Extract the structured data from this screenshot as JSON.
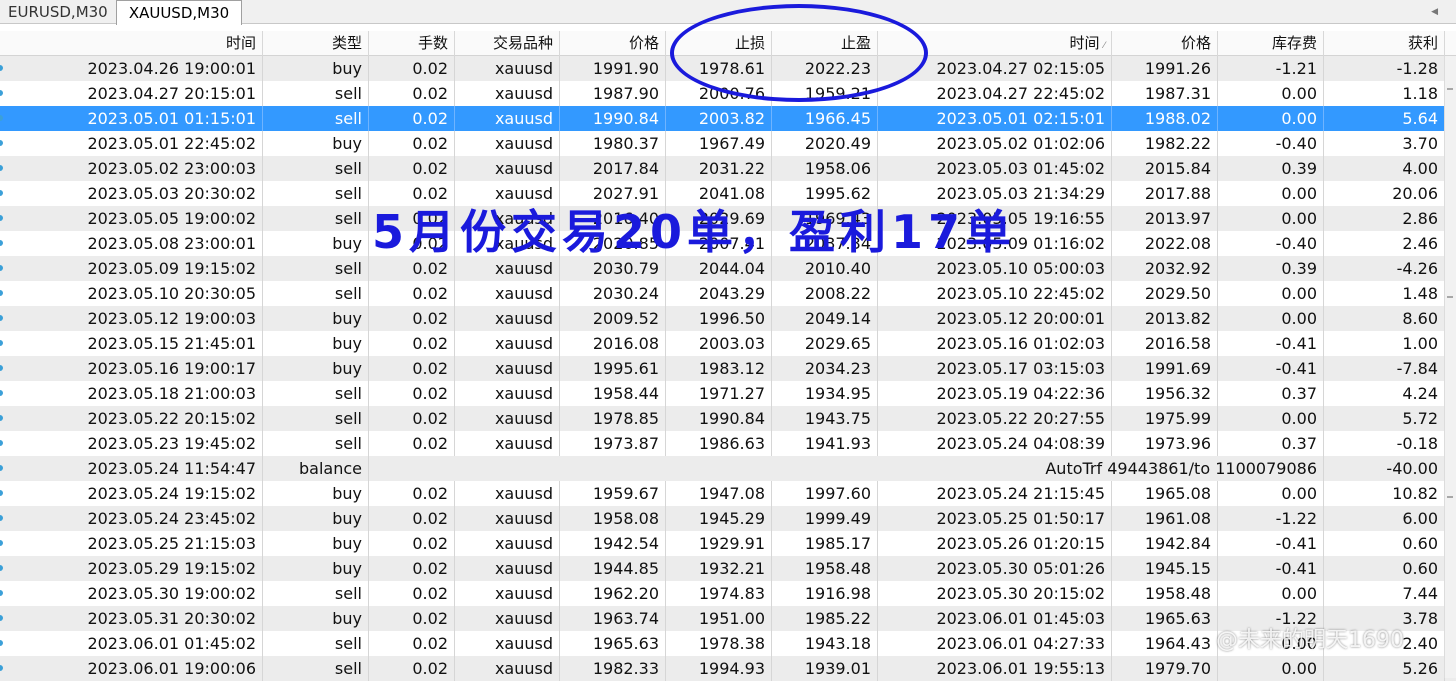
{
  "tabs": [
    {
      "label": "EURUSD,M30"
    },
    {
      "label": "XAUUSD,M30"
    }
  ],
  "columns": [
    {
      "label": "时间"
    },
    {
      "label": "类型"
    },
    {
      "label": "手数"
    },
    {
      "label": "交易品种"
    },
    {
      "label": "价格"
    },
    {
      "label": "止损"
    },
    {
      "label": "止盈"
    },
    {
      "label": "时间"
    },
    {
      "label": "价格"
    },
    {
      "label": "库存费"
    },
    {
      "label": "获利"
    }
  ],
  "rows": [
    [
      "2023.04.26 19:00:01",
      "buy",
      "0.02",
      "xauusd",
      "1991.90",
      "1978.61",
      "2022.23",
      "2023.04.27 02:15:05",
      "1991.26",
      "-1.21",
      "-1.28"
    ],
    [
      "2023.04.27 20:15:01",
      "sell",
      "0.02",
      "xauusd",
      "1987.90",
      "2000.76",
      "1959.21",
      "2023.04.27 22:45:02",
      "1987.31",
      "0.00",
      "1.18"
    ],
    [
      "2023.05.01 01:15:01",
      "sell",
      "0.02",
      "xauusd",
      "1990.84",
      "2003.82",
      "1966.45",
      "2023.05.01 02:15:01",
      "1988.02",
      "0.00",
      "5.64"
    ],
    [
      "2023.05.01 22:45:02",
      "buy",
      "0.02",
      "xauusd",
      "1980.37",
      "1967.49",
      "2020.49",
      "2023.05.02 01:02:06",
      "1982.22",
      "-0.40",
      "3.70"
    ],
    [
      "2023.05.02 23:00:03",
      "sell",
      "0.02",
      "xauusd",
      "2017.84",
      "2031.22",
      "1958.06",
      "2023.05.03 01:45:02",
      "2015.84",
      "0.39",
      "4.00"
    ],
    [
      "2023.05.03 20:30:02",
      "sell",
      "0.02",
      "xauusd",
      "2027.91",
      "2041.08",
      "1995.62",
      "2023.05.03 21:34:29",
      "2017.88",
      "0.00",
      "20.06"
    ],
    [
      "2023.05.05 19:00:02",
      "sell",
      "0.02",
      "xauusd",
      "2016.40",
      "2029.69",
      "1969.43",
      "2023.05.05 19:16:55",
      "2013.97",
      "0.00",
      "2.86"
    ],
    [
      "2023.05.08 23:00:01",
      "buy",
      "0.02",
      "xauusd",
      "2020.85",
      "2007.41",
      "2037.34",
      "2023.05.09 01:16:02",
      "2022.08",
      "-0.40",
      "2.46"
    ],
    [
      "2023.05.09 19:15:02",
      "sell",
      "0.02",
      "xauusd",
      "2030.79",
      "2044.04",
      "2010.40",
      "2023.05.10 05:00:03",
      "2032.92",
      "0.39",
      "-4.26"
    ],
    [
      "2023.05.10 20:30:05",
      "sell",
      "0.02",
      "xauusd",
      "2030.24",
      "2043.29",
      "2008.22",
      "2023.05.10 22:45:02",
      "2029.50",
      "0.00",
      "1.48"
    ],
    [
      "2023.05.12 19:00:03",
      "buy",
      "0.02",
      "xauusd",
      "2009.52",
      "1996.50",
      "2049.14",
      "2023.05.12 20:00:01",
      "2013.82",
      "0.00",
      "8.60"
    ],
    [
      "2023.05.15 21:45:01",
      "buy",
      "0.02",
      "xauusd",
      "2016.08",
      "2003.03",
      "2029.65",
      "2023.05.16 01:02:03",
      "2016.58",
      "-0.41",
      "1.00"
    ],
    [
      "2023.05.16 19:00:17",
      "buy",
      "0.02",
      "xauusd",
      "1995.61",
      "1983.12",
      "2034.23",
      "2023.05.17 03:15:03",
      "1991.69",
      "-0.41",
      "-7.84"
    ],
    [
      "2023.05.18 21:00:03",
      "sell",
      "0.02",
      "xauusd",
      "1958.44",
      "1971.27",
      "1934.95",
      "2023.05.19 04:22:36",
      "1956.32",
      "0.37",
      "4.24"
    ],
    [
      "2023.05.22 20:15:02",
      "sell",
      "0.02",
      "xauusd",
      "1978.85",
      "1990.84",
      "1943.75",
      "2023.05.22 20:27:55",
      "1975.99",
      "0.00",
      "5.72"
    ],
    [
      "2023.05.23 19:45:02",
      "sell",
      "0.02",
      "xauusd",
      "1973.87",
      "1986.63",
      "1941.93",
      "2023.05.24 04:08:39",
      "1973.96",
      "0.37",
      "-0.18"
    ],
    [
      "2023.05.24 19:15:02",
      "buy",
      "0.02",
      "xauusd",
      "1959.67",
      "1947.08",
      "1997.60",
      "2023.05.24 21:15:45",
      "1965.08",
      "0.00",
      "10.82"
    ],
    [
      "2023.05.24 23:45:02",
      "buy",
      "0.02",
      "xauusd",
      "1958.08",
      "1945.29",
      "1999.49",
      "2023.05.25 01:50:17",
      "1961.08",
      "-1.22",
      "6.00"
    ],
    [
      "2023.05.25 21:15:03",
      "buy",
      "0.02",
      "xauusd",
      "1942.54",
      "1929.91",
      "1985.17",
      "2023.05.26 01:20:15",
      "1942.84",
      "-0.41",
      "0.60"
    ],
    [
      "2023.05.29 19:15:02",
      "buy",
      "0.02",
      "xauusd",
      "1944.85",
      "1932.21",
      "1958.48",
      "2023.05.30 05:01:26",
      "1945.15",
      "-0.41",
      "0.60"
    ],
    [
      "2023.05.30 19:00:02",
      "sell",
      "0.02",
      "xauusd",
      "1962.20",
      "1974.83",
      "1916.98",
      "2023.05.30 20:15:02",
      "1958.48",
      "0.00",
      "7.44"
    ],
    [
      "2023.05.31 20:30:02",
      "buy",
      "0.02",
      "xauusd",
      "1963.74",
      "1951.00",
      "1985.22",
      "2023.06.01 01:45:03",
      "1965.63",
      "-1.22",
      "3.78"
    ],
    [
      "2023.06.01 01:45:02",
      "sell",
      "0.02",
      "xauusd",
      "1965.63",
      "1978.38",
      "1943.18",
      "2023.06.01 04:27:33",
      "1964.43",
      "0.00",
      "2.40"
    ],
    [
      "2023.06.01 19:00:06",
      "sell",
      "0.02",
      "xauusd",
      "1982.33",
      "1994.93",
      "1939.01",
      "2023.06.01 19:55:13",
      "1979.70",
      "0.00",
      "5.26"
    ]
  ],
  "balance_row": {
    "time": "2023.05.24 11:54:47",
    "type": "balance",
    "comment": "AutoTrf 49443861/to 1100079086",
    "profit": "-40.00"
  },
  "overlay": {
    "text": "5月份交易20单，盈利17单",
    "color": "#1a1adc"
  },
  "watermark": "@未来的明天1690",
  "colors": {
    "selection": "#3399ff",
    "row_alt": "#ececec",
    "annotation": "#1a1adc"
  }
}
